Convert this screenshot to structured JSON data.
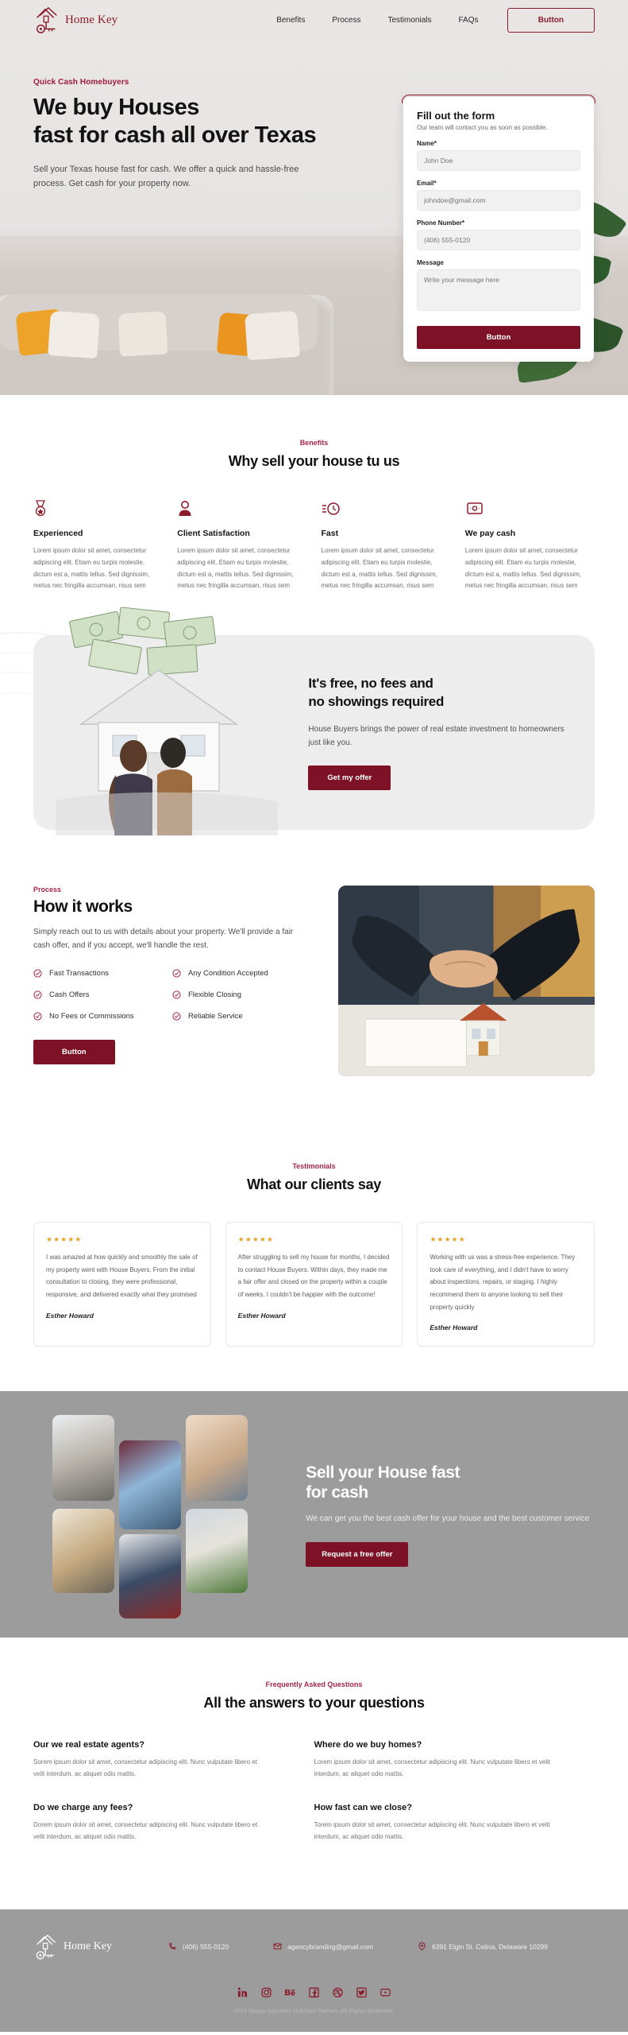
{
  "header": {
    "brand": "Home Key",
    "nav": [
      {
        "label": "Benefits"
      },
      {
        "label": "Process"
      },
      {
        "label": "Testimonials"
      },
      {
        "label": "FAQs"
      }
    ],
    "button": "Button"
  },
  "hero": {
    "eyebrow": "Quick Cash Homebuyers",
    "title_line1": "We buy Houses",
    "title_line2": "fast for cash all over Texas",
    "subtitle": "Sell your Texas house fast for cash. We offer a quick and hassle-free process. Get cash for your property now."
  },
  "form": {
    "title": "Fill out the form",
    "description": "Our team will contact you as soon as possible.",
    "fields": [
      {
        "label": "Name*",
        "placeholder": "John Doe",
        "value": ""
      },
      {
        "label": "Email*",
        "placeholder": "johndoe@gmail.com",
        "value": ""
      },
      {
        "label": "Phone Number*",
        "placeholder": "(406) 555-0120",
        "value": ""
      }
    ],
    "message_label": "Message",
    "message_placeholder": "Write your message here",
    "submit": "Button"
  },
  "benefits": {
    "eyebrow": "Benefits",
    "title": "Why sell your house tu us",
    "items": [
      {
        "icon": "medal-icon",
        "name": "Experienced",
        "text": "Lorem ipsum dolor sit amet, consectetur adipiscing elit. Etiam eu turpis molestie, dictum est a, mattis tellus. Sed dignissim, metus nec fringilla accumsan, risus sem"
      },
      {
        "icon": "person-icon",
        "name": "Client Satisfaction",
        "text": "Lorem ipsum dolor sit amet, consectetur adipiscing elit. Etiam eu turpis molestie, dictum est a, mattis tellus. Sed dignissim, metus nec fringilla accumsan, risus sem"
      },
      {
        "icon": "clock-icon",
        "name": "Fast",
        "text": "Lorem ipsum dolor sit amet, consectetur adipiscing elit. Etiam eu turpis molestie, dictum est a, mattis tellus. Sed dignissim, metus nec fringilla accumsan, risus sem"
      },
      {
        "icon": "cash-icon",
        "name": "We pay cash",
        "text": "Lorem ipsum dolor sit amet, consectetur adipiscing elit. Etiam eu turpis molestie, dictum est a, mattis tellus. Sed dignissim, metus nec fringilla accumsan, risus sem"
      }
    ]
  },
  "free": {
    "title_line1": "It's free, no fees and",
    "title_line2": "no showings required",
    "text": "House Buyers brings the power of real estate investment to homeowners just like you.",
    "button": "Get my offer"
  },
  "process": {
    "eyebrow": "Process",
    "title": "How it works",
    "description": "Simply reach out to us with details about your property. We'll provide a fair cash offer, and if you accept, we'll handle the rest.",
    "features": [
      "Fast Transactions",
      "Any Condition Accepted",
      "Cash Offers",
      "Flexible Closing",
      "No Fees or Commissions",
      "Reliable Service"
    ],
    "button": "Button"
  },
  "testimonials": {
    "eyebrow": "Testimonials",
    "title": "What our clients say",
    "stars": "★★★★★",
    "cards": [
      {
        "quote": "I was amazed at how quickly and smoothly the sale of my property went with House Buyers. From the initial consultation to closing, they were professional, responsive, and delivered exactly what they promised",
        "name": "Esther Howard"
      },
      {
        "quote": "After struggling to sell my house for months, I decided to contact House Buyers. Within days, they made me a fair offer and closed on the property within a couple of weeks. I couldn't be happier with the outcome!",
        "name": "Esther Howard"
      },
      {
        "quote": "Working with us was a stress-free experience. They took care of everything, and I didn't have to worry about inspections, repairs, or staging. I highly recommend them to anyone looking to sell their property quickly",
        "name": "Esther Howard"
      }
    ]
  },
  "cta": {
    "title_line1": "Sell your House fast",
    "title_line2": "for cash",
    "text": "We can get you the best cash offer for your house and the best customer service",
    "button": "Request a free offer"
  },
  "faq": {
    "eyebrow": "Frequently Asked Questions",
    "title": "All the answers to your questions",
    "items": [
      {
        "question": "Our we real estate agents?",
        "answer": "Sorem ipsum dolor sit amet, consectetur adipiscing elit. Nunc vulputate libero et velit interdum, ac aliquet odio mattis."
      },
      {
        "question": "Where do we buy homes?",
        "answer": "Lorem ipsum dolor sit amet, consectetur adipiscing elit. Nunc vulputate libero et velit interdum, ac aliquet odio mattis."
      },
      {
        "question": "Do we charge any fees?",
        "answer": "Dorem ipsum dolor sit amet, consectetur adipiscing elit. Nunc vulputate libero et velit interdum, ac aliquet odio mattis."
      },
      {
        "question": "How fast can we close?",
        "answer": "Torem ipsum dolor sit amet, consectetur adipiscing elit. Nunc vulputate libero et velit interdum, ac aliquet odio mattis."
      }
    ]
  },
  "footer": {
    "brand": "Home Key",
    "phone": "(406) 555-0120",
    "email": "agencybranding@gmail.com",
    "address": "6391 Elgin St. Celina, Delaware 10299",
    "socials": [
      "linkedin-icon",
      "instagram-icon",
      "behance-icon",
      "facebook-icon",
      "dribbble-icon",
      "twitter-icon",
      "youtube-icon"
    ],
    "copyright": "2024 Happy Agencies HubSpot themes. All Rights Reserved."
  },
  "colors": {
    "brand": "#8c1c2c",
    "accent": "#a7264a",
    "button": "#7d1226",
    "star": "#e8a32b",
    "band": "#9c9c9c"
  }
}
